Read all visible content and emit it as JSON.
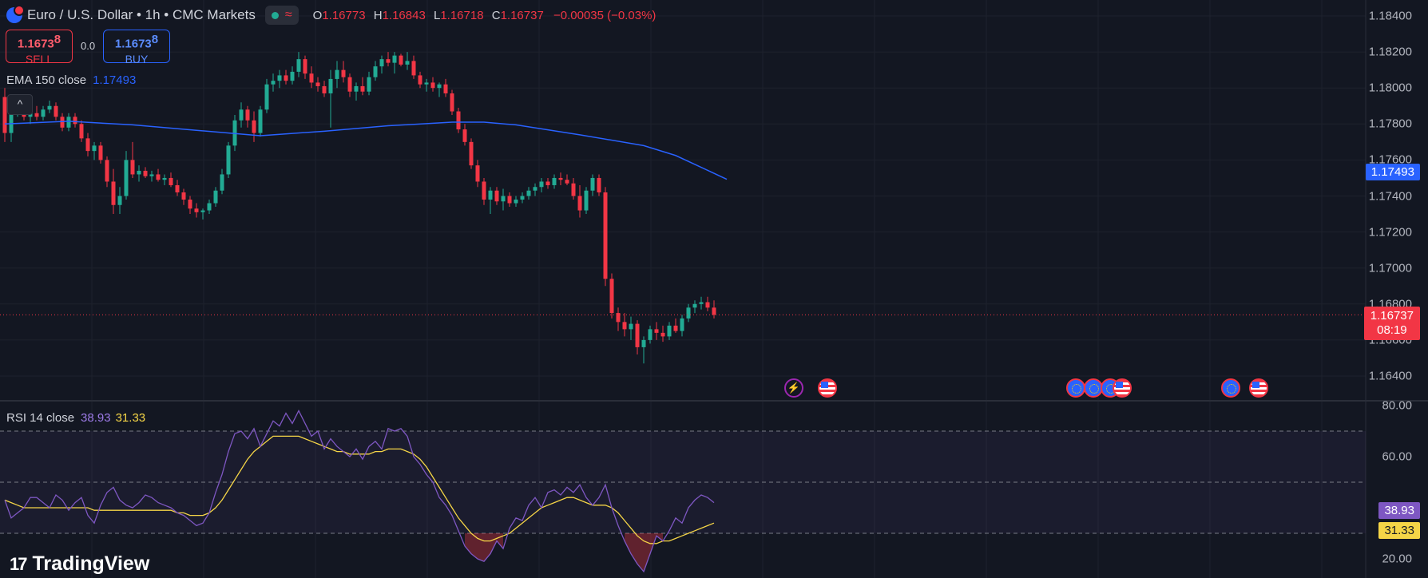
{
  "header": {
    "symbol_title": "Euro / U.S. Dollar • 1h • CMC Markets",
    "ohlc": [
      {
        "k": "O",
        "v": "1.16773"
      },
      {
        "k": "H",
        "v": "1.16843"
      },
      {
        "k": "L",
        "v": "1.16718"
      },
      {
        "k": "C",
        "v": "1.16737"
      }
    ],
    "change": "−0.00035 (−0.03%)"
  },
  "trade": {
    "sell_price": "1.1673",
    "sell_sup": "8",
    "sell_label": "SELL",
    "spread": "0.0",
    "buy_price": "1.1673",
    "buy_sup": "8",
    "buy_label": "BUY"
  },
  "ema_legend": {
    "label": "EMA 150 close",
    "value": "1.17493"
  },
  "rsi_legend": {
    "label": "RSI 14 close",
    "rsi": "38.93",
    "ma": "31.33"
  },
  "collapse_glyph": "^",
  "price_axis": [
    "1.18400",
    "1.18200",
    "1.18000",
    "1.17800",
    "1.17600",
    "1.17400",
    "1.17200",
    "1.17000",
    "1.16800",
    "1.16600",
    "1.16400"
  ],
  "rsi_axis": [
    "80.00",
    "60.00",
    "20.00"
  ],
  "tags": {
    "ema": "1.17493",
    "price": "1.16737",
    "countdown": "08:19",
    "rsi": "38.93",
    "rsi_ma": "31.33"
  },
  "brand": {
    "mark": "17",
    "name": "TradingView"
  },
  "events": [
    {
      "type": "flash",
      "glyph": "⚡"
    },
    {
      "type": "us"
    },
    {
      "type": "eu"
    },
    {
      "type": "eu"
    },
    {
      "type": "eu"
    },
    {
      "type": "us"
    },
    {
      "type": "eu"
    },
    {
      "type": "us"
    }
  ],
  "colors": {
    "bg": "#131722",
    "up": "#22ab94",
    "down": "#f23645",
    "ema": "#2962ff",
    "rsi": "#7e57c2",
    "rsi_ma": "#f5d547"
  },
  "chart_data": [
    {
      "type": "candlestick",
      "title": "Euro / U.S. Dollar • 1h • CMC Markets",
      "ylim": [
        1.163,
        1.1845
      ],
      "grid": true,
      "candles": [
        [
          1.1795,
          1.18,
          1.177,
          1.1775
        ],
        [
          1.1775,
          1.179,
          1.177,
          1.1786
        ],
        [
          1.1786,
          1.1793,
          1.1784,
          1.1788
        ],
        [
          1.1788,
          1.1791,
          1.1782,
          1.1784
        ],
        [
          1.1784,
          1.1788,
          1.178,
          1.1786
        ],
        [
          1.1786,
          1.179,
          1.1782,
          1.1784
        ],
        [
          1.1784,
          1.179,
          1.1782,
          1.1788
        ],
        [
          1.1788,
          1.1793,
          1.1786,
          1.179
        ],
        [
          1.179,
          1.1792,
          1.1782,
          1.1784
        ],
        [
          1.1784,
          1.1786,
          1.1776,
          1.1778
        ],
        [
          1.1778,
          1.1786,
          1.1776,
          1.1784
        ],
        [
          1.1784,
          1.1786,
          1.1778,
          1.178
        ],
        [
          1.178,
          1.1782,
          1.177,
          1.1772
        ],
        [
          1.1772,
          1.1775,
          1.1762,
          1.1765
        ],
        [
          1.1765,
          1.177,
          1.176,
          1.1768
        ],
        [
          1.1768,
          1.177,
          1.1758,
          1.176
        ],
        [
          1.176,
          1.1762,
          1.1745,
          1.1748
        ],
        [
          1.1748,
          1.1755,
          1.173,
          1.1735
        ],
        [
          1.1735,
          1.1745,
          1.173,
          1.174
        ],
        [
          1.174,
          1.1765,
          1.1738,
          1.176
        ],
        [
          1.176,
          1.177,
          1.175,
          1.1752
        ],
        [
          1.1752,
          1.1757,
          1.1748,
          1.1754
        ],
        [
          1.1754,
          1.1756,
          1.175,
          1.1751
        ],
        [
          1.1751,
          1.1754,
          1.1748,
          1.1752
        ],
        [
          1.1752,
          1.1755,
          1.1748,
          1.1749
        ],
        [
          1.1749,
          1.1752,
          1.1746,
          1.175
        ],
        [
          1.175,
          1.1753,
          1.1745,
          1.1746
        ],
        [
          1.1746,
          1.1749,
          1.174,
          1.1742
        ],
        [
          1.1742,
          1.1744,
          1.1735,
          1.1738
        ],
        [
          1.1738,
          1.174,
          1.173,
          1.1733
        ],
        [
          1.1733,
          1.1736,
          1.1728,
          1.1731
        ],
        [
          1.1731,
          1.1733,
          1.1727,
          1.1732
        ],
        [
          1.1732,
          1.1738,
          1.173,
          1.1736
        ],
        [
          1.1736,
          1.1745,
          1.1734,
          1.1743
        ],
        [
          1.1743,
          1.1755,
          1.1741,
          1.1752
        ],
        [
          1.1752,
          1.177,
          1.175,
          1.1768
        ],
        [
          1.1768,
          1.1785,
          1.1765,
          1.1782
        ],
        [
          1.1782,
          1.1792,
          1.1778,
          1.1788
        ],
        [
          1.1788,
          1.179,
          1.1778,
          1.1782
        ],
        [
          1.1782,
          1.1787,
          1.177,
          1.1775
        ],
        [
          1.1775,
          1.179,
          1.1773,
          1.1788
        ],
        [
          1.1788,
          1.1805,
          1.1786,
          1.1802
        ],
        [
          1.1802,
          1.1808,
          1.1798,
          1.1804
        ],
        [
          1.1804,
          1.181,
          1.18,
          1.1807
        ],
        [
          1.1807,
          1.181,
          1.1802,
          1.1804
        ],
        [
          1.1804,
          1.1812,
          1.1802,
          1.1809
        ],
        [
          1.1809,
          1.182,
          1.1806,
          1.1816
        ],
        [
          1.1816,
          1.1818,
          1.1805,
          1.1808
        ],
        [
          1.1808,
          1.1812,
          1.18,
          1.1803
        ],
        [
          1.1803,
          1.1806,
          1.1798,
          1.1801
        ],
        [
          1.1801,
          1.1804,
          1.1795,
          1.1797
        ],
        [
          1.1797,
          1.181,
          1.1778,
          1.1805
        ],
        [
          1.1805,
          1.1815,
          1.18,
          1.181
        ],
        [
          1.181,
          1.1815,
          1.1803,
          1.1806
        ],
        [
          1.1806,
          1.1808,
          1.1795,
          1.1798
        ],
        [
          1.1798,
          1.1803,
          1.1793,
          1.1801
        ],
        [
          1.1801,
          1.1806,
          1.1796,
          1.1798
        ],
        [
          1.1798,
          1.1809,
          1.1796,
          1.1806
        ],
        [
          1.1806,
          1.1815,
          1.1804,
          1.1812
        ],
        [
          1.1812,
          1.1818,
          1.1808,
          1.1816
        ],
        [
          1.1816,
          1.182,
          1.1812,
          1.1814
        ],
        [
          1.1814,
          1.182,
          1.1808,
          1.1818
        ],
        [
          1.1818,
          1.1819,
          1.1812,
          1.1813
        ],
        [
          1.1813,
          1.182,
          1.181,
          1.1815
        ],
        [
          1.1815,
          1.1818,
          1.1805,
          1.1807
        ],
        [
          1.1807,
          1.1809,
          1.18,
          1.1802
        ],
        [
          1.1802,
          1.1805,
          1.1798,
          1.1803
        ],
        [
          1.1803,
          1.1806,
          1.1798,
          1.18
        ],
        [
          1.18,
          1.1803,
          1.1795,
          1.1802
        ],
        [
          1.1802,
          1.1805,
          1.1795,
          1.1797
        ],
        [
          1.1797,
          1.1799,
          1.1785,
          1.1787
        ],
        [
          1.1787,
          1.1789,
          1.1775,
          1.1777
        ],
        [
          1.1777,
          1.178,
          1.1768,
          1.177
        ],
        [
          1.177,
          1.1772,
          1.1755,
          1.1757
        ],
        [
          1.1757,
          1.176,
          1.1745,
          1.1748
        ],
        [
          1.1748,
          1.175,
          1.1735,
          1.1738
        ],
        [
          1.1738,
          1.1745,
          1.173,
          1.1743
        ],
        [
          1.1743,
          1.1745,
          1.1735,
          1.1737
        ],
        [
          1.1737,
          1.1744,
          1.1732,
          1.174
        ],
        [
          1.174,
          1.1742,
          1.1734,
          1.1736
        ],
        [
          1.1736,
          1.174,
          1.1734,
          1.1738
        ],
        [
          1.1738,
          1.1742,
          1.1736,
          1.174
        ],
        [
          1.174,
          1.1745,
          1.1738,
          1.1743
        ],
        [
          1.1743,
          1.1747,
          1.174,
          1.1745
        ],
        [
          1.1745,
          1.175,
          1.1742,
          1.1748
        ],
        [
          1.1748,
          1.175,
          1.1744,
          1.1746
        ],
        [
          1.1746,
          1.1752,
          1.1744,
          1.175
        ],
        [
          1.175,
          1.1753,
          1.1746,
          1.1749
        ],
        [
          1.1749,
          1.1752,
          1.1746,
          1.1747
        ],
        [
          1.1747,
          1.175,
          1.1738,
          1.174
        ],
        [
          1.174,
          1.1746,
          1.1728,
          1.1732
        ],
        [
          1.1732,
          1.1745,
          1.173,
          1.1743
        ],
        [
          1.1743,
          1.1752,
          1.174,
          1.175
        ],
        [
          1.175,
          1.1752,
          1.174,
          1.1742
        ],
        [
          1.1742,
          1.1745,
          1.169,
          1.1694
        ],
        [
          1.1694,
          1.1697,
          1.1672,
          1.1675
        ],
        [
          1.1675,
          1.1678,
          1.1665,
          1.167
        ],
        [
          1.167,
          1.1675,
          1.1662,
          1.1666
        ],
        [
          1.1666,
          1.1673,
          1.166,
          1.1669
        ],
        [
          1.1669,
          1.1671,
          1.1652,
          1.1656
        ],
        [
          1.1656,
          1.1662,
          1.1647,
          1.166
        ],
        [
          1.166,
          1.1668,
          1.1658,
          1.1666
        ],
        [
          1.1666,
          1.167,
          1.166,
          1.1664
        ],
        [
          1.1664,
          1.1668,
          1.1659,
          1.1662
        ],
        [
          1.1662,
          1.167,
          1.166,
          1.1668
        ],
        [
          1.1668,
          1.1672,
          1.1664,
          1.1665
        ],
        [
          1.1665,
          1.1674,
          1.1662,
          1.1672
        ],
        [
          1.1672,
          1.168,
          1.167,
          1.1678
        ],
        [
          1.1678,
          1.1682,
          1.1675,
          1.168
        ],
        [
          1.168,
          1.1684,
          1.1677,
          1.1681
        ],
        [
          1.1681,
          1.1684,
          1.1676,
          1.1678
        ],
        [
          1.1678,
          1.1682,
          1.1672,
          1.1674
        ]
      ],
      "ema": [
        [
          0,
          1.178
        ],
        [
          10,
          1.17815
        ],
        [
          20,
          1.17795
        ],
        [
          30,
          1.17765
        ],
        [
          40,
          1.17735
        ],
        [
          50,
          1.1776
        ],
        [
          60,
          1.1779
        ],
        [
          70,
          1.1781
        ],
        [
          75,
          1.1781
        ],
        [
          80,
          1.17795
        ],
        [
          90,
          1.1774
        ],
        [
          100,
          1.1768
        ],
        [
          105,
          1.17625
        ],
        [
          113,
          1.17493
        ]
      ]
    },
    {
      "type": "line",
      "title": "RSI 14 close",
      "ylim": [
        15,
        80
      ],
      "bands": [
        70,
        50,
        30
      ],
      "series": [
        {
          "name": "RSI",
          "values": [
            43,
            36,
            38,
            40,
            44,
            44,
            42,
            40,
            45,
            43,
            39,
            42,
            44,
            37,
            34,
            41,
            46,
            48,
            43,
            41,
            40,
            42,
            45,
            44,
            42,
            41,
            40,
            38,
            37,
            35,
            33,
            34,
            38,
            46,
            53,
            62,
            69,
            70,
            67,
            71,
            64,
            69,
            74,
            72,
            77,
            73,
            78,
            73,
            68,
            70,
            63,
            67,
            64,
            62,
            60,
            63,
            59,
            64,
            66,
            63,
            71,
            70,
            71,
            68,
            60,
            57,
            53,
            50,
            44,
            41,
            37,
            31,
            25,
            22,
            20,
            19,
            22,
            27,
            24,
            32,
            36,
            35,
            41,
            44,
            40,
            46,
            47,
            45,
            48,
            46,
            49,
            44,
            41,
            44,
            49,
            40,
            33,
            27,
            22,
            18,
            15,
            22,
            29,
            27,
            31,
            36,
            34,
            40,
            43,
            45,
            44,
            42
          ]
        },
        {
          "name": "MA",
          "values": [
            43,
            42,
            41,
            40,
            40,
            40,
            40,
            40,
            40,
            40,
            40,
            40,
            40,
            40,
            39,
            39,
            39,
            39,
            39,
            39,
            39,
            39,
            39,
            39,
            39,
            39,
            39,
            38,
            38,
            37,
            37,
            37,
            38,
            40,
            43,
            47,
            51,
            55,
            59,
            62,
            64,
            66,
            68,
            68,
            68,
            68,
            68,
            67,
            66,
            65,
            64,
            63,
            62,
            62,
            61,
            61,
            61,
            61,
            62,
            62,
            63,
            63,
            63,
            62,
            61,
            59,
            56,
            52,
            48,
            44,
            40,
            36,
            33,
            30,
            28,
            27,
            27,
            28,
            29,
            30,
            32,
            34,
            36,
            38,
            40,
            41,
            42,
            43,
            44,
            44,
            43,
            42,
            41,
            41,
            41,
            40,
            38,
            35,
            32,
            29,
            27,
            26,
            26,
            27,
            27,
            28,
            29,
            30,
            31,
            32,
            33,
            34
          ]
        }
      ]
    }
  ]
}
